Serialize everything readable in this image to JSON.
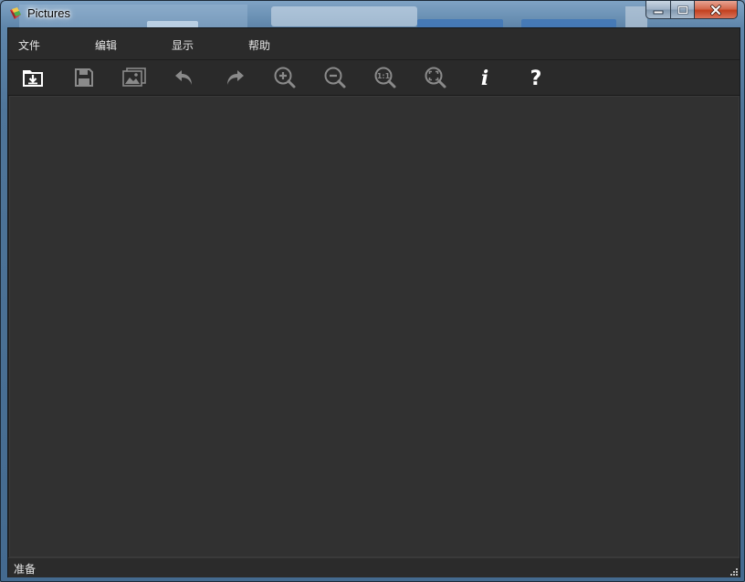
{
  "window": {
    "title": "Pictures",
    "icon": "app-pictures-icon"
  },
  "menu": {
    "items": [
      {
        "label": "文件"
      },
      {
        "label": "编辑"
      },
      {
        "label": "显示"
      },
      {
        "label": "帮助"
      }
    ]
  },
  "toolbar": {
    "buttons": [
      {
        "icon": "open-folder-icon"
      },
      {
        "icon": "save-icon"
      },
      {
        "icon": "image-icon"
      },
      {
        "icon": "undo-icon"
      },
      {
        "icon": "redo-icon"
      },
      {
        "icon": "zoom-in-icon"
      },
      {
        "icon": "zoom-out-icon"
      },
      {
        "icon": "actual-size-icon",
        "text": "1:1"
      },
      {
        "icon": "fit-window-icon"
      },
      {
        "icon": "info-icon",
        "text": "i"
      },
      {
        "icon": "help-icon",
        "text": "?"
      }
    ]
  },
  "status": {
    "text": "准备"
  },
  "colors": {
    "canvas": "#313131",
    "chrome": "#2b2b2b",
    "icon_active": "#ffffff",
    "icon_inactive": "#8a8a8a"
  }
}
